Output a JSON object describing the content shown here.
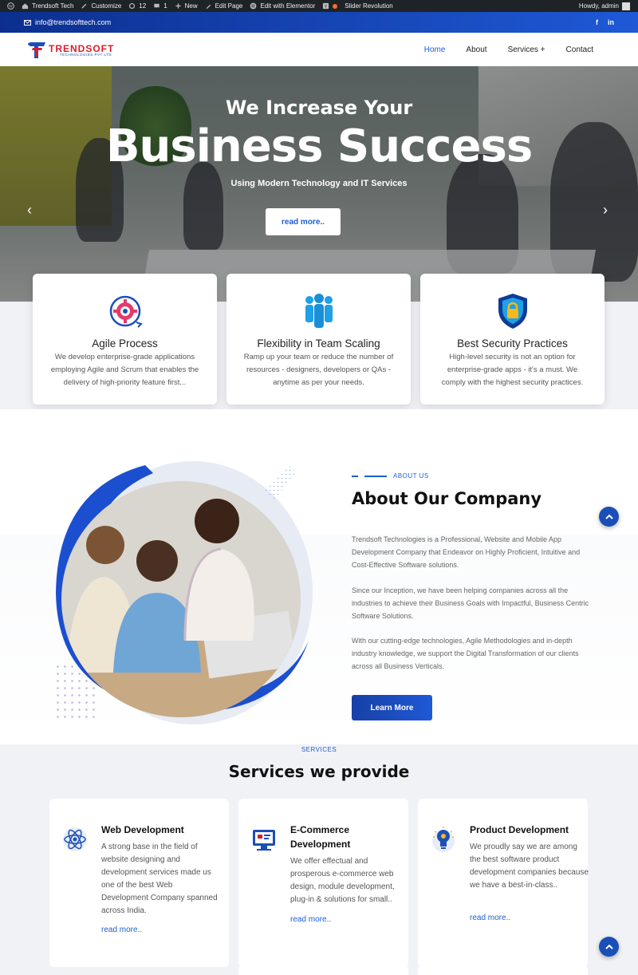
{
  "adminbar": {
    "items": [
      "Trendsoft Tech",
      "Customize",
      "12",
      "1",
      "New",
      "Edit Page",
      "Edit with Elementor",
      "Slider Revolution"
    ],
    "greeting": "Howdy, admin"
  },
  "topbar": {
    "email": "info@trendsofttech.com",
    "social": [
      "f",
      "in"
    ]
  },
  "brand": {
    "name": "TRENDSOFT",
    "tagline": "TECHNOLOGIES PVT LTD"
  },
  "menu": [
    {
      "label": "Home"
    },
    {
      "label": "About"
    },
    {
      "label": "Services +"
    },
    {
      "label": "Contact"
    }
  ],
  "hero": {
    "line1": "We Increase Your",
    "title": "Business Success",
    "subtitle": "Using Modern Technology and IT Services",
    "button": "read more..",
    "prev": "‹",
    "next": "›"
  },
  "features": [
    {
      "title": "Agile Process",
      "text": "We develop enterprise-grade applications employing Agile and Scrum that enables the delivery of high-priority feature first...",
      "icon": "agile-gear-icon"
    },
    {
      "title": "Flexibility in Team Scaling",
      "text": "Ramp up your team or reduce the number of resources - designers, developers or QAs - anytime as per your needs.",
      "icon": "team-icon"
    },
    {
      "title": "Best Security Practices",
      "text": "High-level security is not an option for enterprise-grade apps - it's a must. We comply with the highest security practices.",
      "icon": "shield-lock-icon"
    }
  ],
  "about": {
    "tag": "ABOUT US",
    "title": "About Our Company",
    "paragraphs": [
      "Trendsoft Technologies is a Professional, Website and Mobile App Development Company that Endeavor on Highly Proficient, Intuitive and Cost-Effective Software solutions.",
      "Since our Inception, we have been helping companies across all the industries to achieve their Business Goals with Impactful, Business Centric Software Solutions.",
      "With our cutting-edge technologies, Agile Methodologies and in-depth industry knowledge, we support the Digital Transformation of our clients across all Business Verticals."
    ],
    "button": "Learn More"
  },
  "services": {
    "tag": "SERVICES",
    "title": "Services we provide",
    "items": [
      {
        "title": "Web Development",
        "text": "A strong base in the field of website designing and development services made us one of the best Web Development Company spanned across India.",
        "link": "read more..",
        "icon": "atom-icon"
      },
      {
        "title": "E-Commerce Development",
        "text": "We offer effectual and prosperous e-commerce web design, module development, plug-in & solutions for small..",
        "link": "read more..",
        "icon": "ecommerce-screen-icon"
      },
      {
        "title": "Product Development",
        "text": "We proudly say we are among the best software product development companies because we have a best-in-class..",
        "link": "read more..",
        "icon": "lightbulb-icon"
      }
    ]
  },
  "colors": {
    "accent": "#1c5fd2",
    "brand_red": "#d81e2c",
    "dark_blue": "#1b4fb8"
  }
}
